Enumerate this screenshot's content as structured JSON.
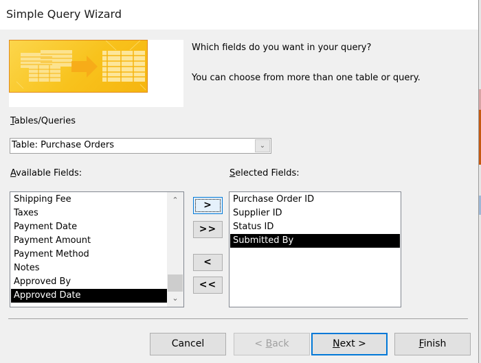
{
  "window": {
    "title": "Simple Query Wizard"
  },
  "banner": {
    "icon": "tables-to-query-illustration"
  },
  "prompt": {
    "question": "Which fields do you want in your query?",
    "hint": "You can choose from more than one table or query."
  },
  "tables_queries": {
    "label_accel": "T",
    "label_rest": "ables/Queries",
    "selected": "Table: Purchase Orders"
  },
  "available_fields": {
    "label_accel": "A",
    "label_rest": "vailable Fields:",
    "items": [
      "Shipping Fee",
      "Taxes",
      "Payment Date",
      "Payment Amount",
      "Payment Method",
      "Notes",
      "Approved By",
      "Approved Date"
    ],
    "selected_index": 7,
    "scroll_position": 1.0
  },
  "selected_fields": {
    "label_accel": "S",
    "label_rest": "elected Fields:",
    "items": [
      "Purchase Order ID",
      "Supplier ID",
      "Status ID",
      "Submitted By"
    ],
    "selected_index": 3
  },
  "move_buttons": {
    "add_one": ">",
    "add_all": ">>",
    "remove_one": "<",
    "remove_all": "<<"
  },
  "footer": {
    "cancel": "Cancel",
    "back_prefix": "< ",
    "back_accel": "B",
    "back_rest": "ack",
    "next_accel": "N",
    "next_rest": "ext >",
    "finish_accel": "F",
    "finish_rest": "inish"
  },
  "colors": {
    "accent": "#0078d7",
    "selection": "#000000",
    "banner_yellow": "#f8c21c"
  }
}
